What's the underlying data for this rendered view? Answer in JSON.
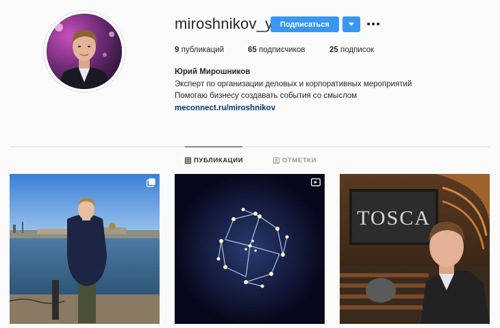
{
  "profile": {
    "username": "miroshnikov_y",
    "follow_label": "Подписаться",
    "stats": {
      "posts_count": "9",
      "posts_label": "публикаций",
      "followers_count": "65",
      "followers_label": "подписчиков",
      "following_count": "25",
      "following_label": "подписок"
    },
    "full_name": "Юрий Мирошников",
    "bio_lines": [
      "Эксперт по организации деловых и корпоративных мероприятий",
      "Помогаю бизнесу создавать события со смыслом"
    ],
    "website": "meconnect.ru/miroshnikov"
  },
  "tabs": {
    "posts": "ПУБЛИКАЦИИ",
    "tagged": "ОТМЕТКИ"
  },
  "posts": [
    {
      "type": "carousel",
      "icon": "multiple-photos-icon"
    },
    {
      "type": "video",
      "icon": "igtv-icon"
    },
    {
      "type": "photo",
      "sign_text": "TOSCA"
    }
  ],
  "colors": {
    "accent": "#3897f0",
    "link": "#003569",
    "divider": "#dbdbdb"
  }
}
